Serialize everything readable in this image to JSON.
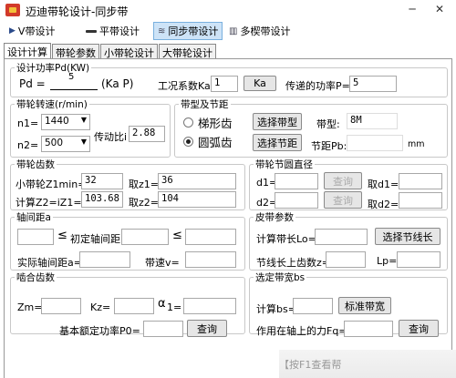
{
  "window": {
    "title": "迈迪带轮设计-同步带",
    "minimize": "─",
    "close": "✕"
  },
  "toolbar": {
    "v_belt": "V带设计",
    "flat_belt": "平带设计",
    "sync_belt": "同步带设计",
    "multi_belt": "多楔带设计"
  },
  "tabs": [
    "设计计算",
    "带轮参数",
    "小带轮设计",
    "大带轮设计"
  ],
  "design_power": {
    "legend": "设计功率Pd(KW)",
    "pd_label": "Pd =",
    "pd_value": "5",
    "pd_tail": "(Ka P)",
    "ka_label": "工况系数Ka=",
    "ka_value": "1",
    "ka_button": "Ka",
    "p_label": "传递的功率P=",
    "p_value": "5"
  },
  "pulley_speed": {
    "legend": "带轮转速(r/min)",
    "n1_label": "n1=",
    "n1_value": "1440",
    "n2_label": "n2=",
    "n2_value": "500",
    "ratio_label": "传动比i",
    "ratio_value": "2.88"
  },
  "belt_pitch": {
    "legend": "带型及节距",
    "trapezoid_label": "梯形齿",
    "arc_label": "圆弧齿",
    "select_type_button": "选择带型",
    "type_label": "带型:",
    "type_value": "8M",
    "select_pitch_button": "选择节距",
    "pitch_label": "节距Pb:",
    "pitch_value": "",
    "pitch_unit": "mm"
  },
  "pulley_teeth": {
    "legend": "带轮齿数",
    "zmin_label": "小带轮Z1min=",
    "zmin_value": "32",
    "z1_label": "取z1=",
    "z1_value": "36",
    "z2_calc_label": "计算Z2=iZ1=",
    "z2_calc_value": "103.68",
    "z2_label": "取z2=",
    "z2_value": "104"
  },
  "pitch_diameter": {
    "legend": "带轮节圆直径",
    "d1_label": "d1=",
    "d1_value": "",
    "query1": "查询",
    "take_d1": "取d1=",
    "take_d1_value": "",
    "d2_label": "d2=",
    "d2_value": "",
    "query2": "查询",
    "take_d2": "取d2=",
    "take_d2_value": ""
  },
  "center_distance": {
    "legend": "轴间距a",
    "le1": "≤",
    "initial_label": "初定轴间距",
    "le2": "≤",
    "actual_label": "实际轴间距a=",
    "speed_label": "带速v="
  },
  "belt_params": {
    "legend": "皮带参数",
    "calc_length_label": "计算带长Lo=",
    "select_length_button": "选择节线长",
    "teeth_label": "节线长上齿数z=",
    "lp_label": "Lp="
  },
  "mesh_teeth": {
    "legend": "啮合齿数",
    "zm_label": "Zm=",
    "kz_label": "Kz=",
    "alpha_label": "α",
    "alpha_sub": "1=",
    "p0_label": "基本额定功率P0=",
    "query": "查询"
  },
  "belt_width": {
    "legend": "选定带宽bs",
    "calc_label": "计算bs=",
    "std_button": "标准带宽",
    "force_label": "作用在轴上的力Fq=",
    "query": "查询"
  },
  "status": {
    "hint": "【按F1查看帮"
  }
}
